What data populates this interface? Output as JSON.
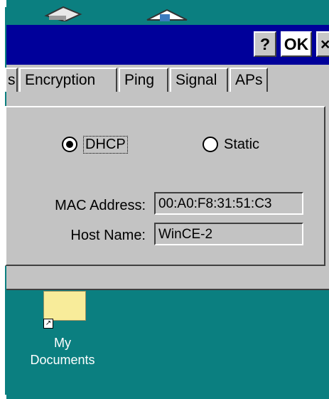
{
  "window": {
    "title_buttons": {
      "help": "?",
      "ok": "OK",
      "close": "×"
    }
  },
  "tabs": [
    {
      "label": "s"
    },
    {
      "label": "Encryption"
    },
    {
      "label": "Ping"
    },
    {
      "label": "Signal"
    },
    {
      "label": "APs"
    }
  ],
  "ip_mode": {
    "dhcp_label": "DHCP",
    "static_label": "Static",
    "selected": "DHCP"
  },
  "fields": {
    "mac_label": "MAC Address:",
    "mac_value": "00:A0:F8:31:51:C3",
    "host_label": "Host Name:",
    "host_value": "WinCE-2"
  },
  "desktop": {
    "mydocs_line1": "My",
    "mydocs_line2": "Documents"
  },
  "colors": {
    "desktop": "#0b7f80",
    "titlebar": "#00009a",
    "dialog": "#c3c3c3"
  }
}
